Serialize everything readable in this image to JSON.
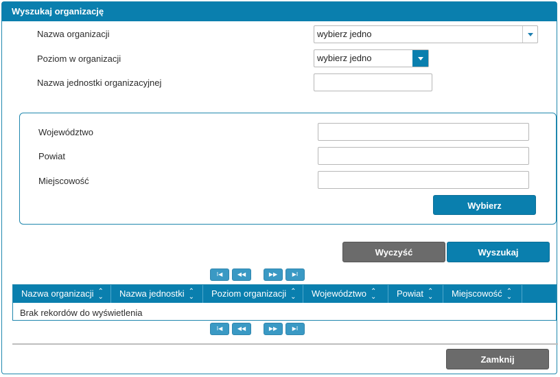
{
  "dialog": {
    "title": "Wyszukaj organizację"
  },
  "form": {
    "org_name_label": "Nazwa organizacji",
    "org_name_value": "wybierz jedno",
    "level_label": "Poziom w organizacji",
    "level_value": "wybierz jedno",
    "unit_name_label": "Nazwa jednostki organizacyjnej",
    "unit_name_value": ""
  },
  "location": {
    "voivodeship_label": "Województwo",
    "voivodeship_value": "",
    "county_label": "Powiat",
    "county_value": "",
    "city_label": "Miejscowość",
    "city_value": "",
    "select_button": "Wybierz"
  },
  "actions": {
    "clear_button": "Wyczyść",
    "search_button": "Wyszukaj",
    "close_button": "Zamknij"
  },
  "pager": {
    "first": "I◀",
    "prev": "◀◀",
    "next": "▶▶",
    "last": "▶I"
  },
  "table": {
    "columns": [
      "Nazwa organizacji",
      "Nazwa jednostki",
      "Poziom organizacji",
      "Województwo",
      "Powiat",
      "Miejscowość"
    ],
    "empty_message": "Brak rekordów do wyświetlenia",
    "sort_icon": "sort-arrows-icon"
  },
  "colors": {
    "accent": "#0a7fae",
    "button_gray": "#6b6b6b"
  }
}
